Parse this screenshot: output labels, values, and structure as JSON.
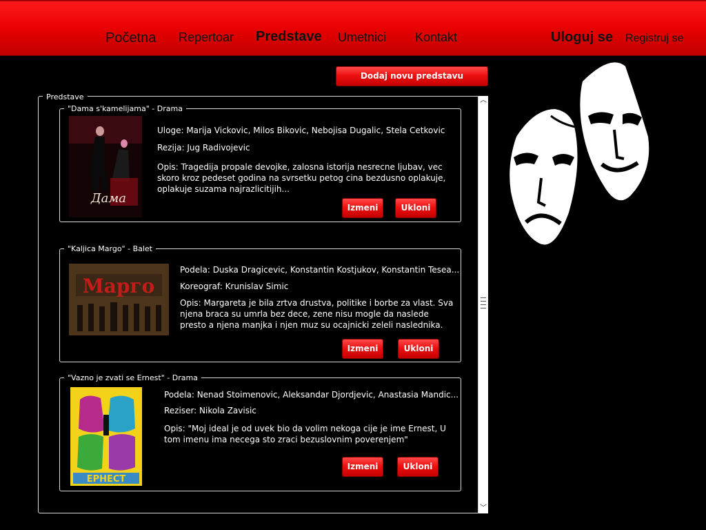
{
  "nav": {
    "home": "Početna",
    "repertoar": "Repertoar",
    "predstave": "Predstave",
    "umetnici": "Umetnici",
    "kontakt": "Kontakt",
    "login": "Uloguj se",
    "register": "Registruj se"
  },
  "add_button": "Dodaj novu predstavu",
  "list_legend": "Predstave",
  "shows": [
    {
      "title": "\"Dama s'kamelijama\" - Drama",
      "line1": "Uloge: Marija Vickovic, Milos Bikovic, Nebojisa Dugalic, Stela Cetkovic",
      "line2": "Rezija: Jug Radivojevic",
      "desc": "Opis: Tragedija propale devojke, zalosna istorija nesrecne ljubav, vec skoro kroz pedeset godina na svrsetku petog cina bezdusno oplakuje, oplakuje suzama najrazlicitijih...",
      "poster_text": "Дама"
    },
    {
      "title": "\"Kaljica Margo\" - Balet",
      "line1": "Podela: Duska Dragicevic, Konstantin Kostjukov, Konstantin Tesea...",
      "line2": "Koreograf: Krunislav Simic",
      "desc": "Opis: Margareta je bila zrtva drustva, politike i borbe za vlast. Sva njena braca su umrla bez dece, zene nisu mogle da naslede presto a njena manjka i njen muz su ocajnicki zeleli naslednika.",
      "poster_text": "Марго"
    },
    {
      "title": "\"Vazno je zvati se Ernest\" - Drama",
      "line1": "Podela: Nenad Stoimenovic, Aleksandar Djordjevic, Anastasia Mandic...",
      "line2": "Reziser: Nikola Zavisic",
      "desc": "Opis: \"Moj ideal je od uvek bio da volim nekoga cije je ime Ernest, U tom imenu ima necega sto zraci bezuslovnim poverenjem\"",
      "poster_text": "ЕРНЕСТ"
    }
  ],
  "edit_label": "Izmeni",
  "remove_label": "Ukloni",
  "colors": {
    "accent": "#e60000",
    "background": "#000000"
  },
  "icons": [
    "theater-masks-icon",
    "chevron-up-icon",
    "chevron-down-icon"
  ]
}
